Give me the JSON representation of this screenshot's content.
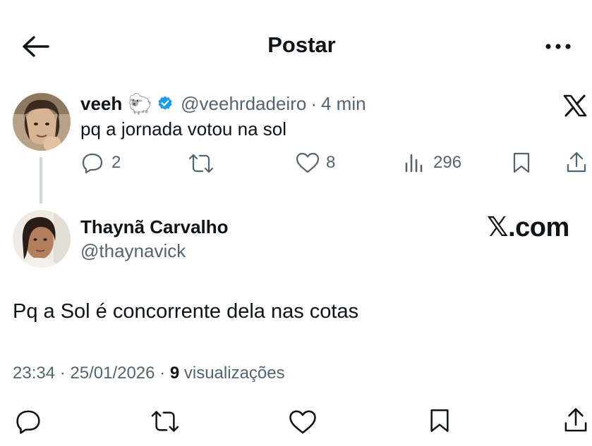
{
  "header": {
    "title": "Postar"
  },
  "parent_post": {
    "display_name": "veeh",
    "emoji": "🐑",
    "handle": "@veehrdadeiro",
    "separator": "·",
    "time": "4 min",
    "text": "pq a jornada votou na sol",
    "replies": "2",
    "likes": "8",
    "views": "296"
  },
  "reply_post": {
    "display_name": "Thaynã Carvalho",
    "handle": "@thaynavick",
    "brand": "𝕏.com",
    "text": "Pq a Sol é concorrente dela nas cotas",
    "timestamp": "23:34 · 25/01/2026 · ",
    "views_count": "9",
    "views_label": " visualizações"
  },
  "colors": {
    "text": "#0f1419",
    "secondary": "#536471",
    "verified": "#1d9bf0",
    "thread_line": "#cfd9de"
  },
  "icons": [
    "back-arrow-icon",
    "more-icon",
    "verified-badge-icon",
    "x-logo-icon",
    "reply-icon",
    "repost-icon",
    "like-icon",
    "views-icon",
    "bookmark-icon",
    "share-icon"
  ]
}
